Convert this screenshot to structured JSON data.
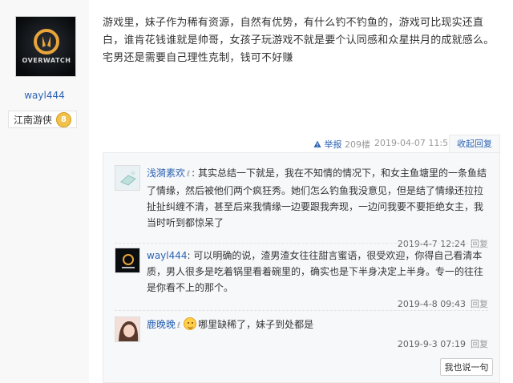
{
  "user": {
    "name": "wayl444",
    "level_title": "江南游侠",
    "level_num": "8",
    "avatar_logo_text": "OVERWATCH"
  },
  "post": {
    "text": "游戏里，妹子作为稀有资源，自然有优势，有什么钓不钓鱼的，游戏可比现实还直白，谁肯花钱谁就是帅哥，女孩子玩游戏不就是要个认同感和众星拱月的成就感么。宅男还是需要自己理性克制，钱可不好赚"
  },
  "tail": {
    "report": "举报",
    "floor": "209楼",
    "time": "2019-04-07 11:56",
    "collapse": "收起回复"
  },
  "replies": [
    {
      "name": "浅漪素欢",
      "text": ": 其实总结一下就是，我在不知情的情况下，和女主鱼塘里的一条鱼结了情缘，然后被他们两个疯狂秀。她们怎么钓鱼我没意见，但是结了情缘还拉拉扯扯纠缠不清，甚至后来我情缘一边要跟我奔现，一边问我要不要拒绝女主，我当时听到都惊呆了",
      "time": "2019-4-7 12:24",
      "reply": "回复"
    },
    {
      "name": "wayl444",
      "text": ": 可以明确的说，渣男渣女往往甜言蜜语，很受欢迎，你得自己看清本质，男人很多是吃着锅里看着碗里的，确实也是下半身决定上半身。专一的往往是你看不上的那个。",
      "time": "2019-4-8 09:43",
      "reply": "回复"
    },
    {
      "name": "鹿晚晚",
      "text": "哪里缺稀了，妹子到处都是",
      "time": "2019-9-3 07:19",
      "reply": "回复"
    }
  ],
  "say_button": "我也说一句",
  "colors": {
    "link": "#2d64b3",
    "muted": "#999999",
    "panel": "#f7f8fa"
  },
  "icons": [
    "overwatch-logo-avatar",
    "level-badge-icon",
    "report-icon",
    "user-mark-icon",
    "emoji-icon"
  ]
}
